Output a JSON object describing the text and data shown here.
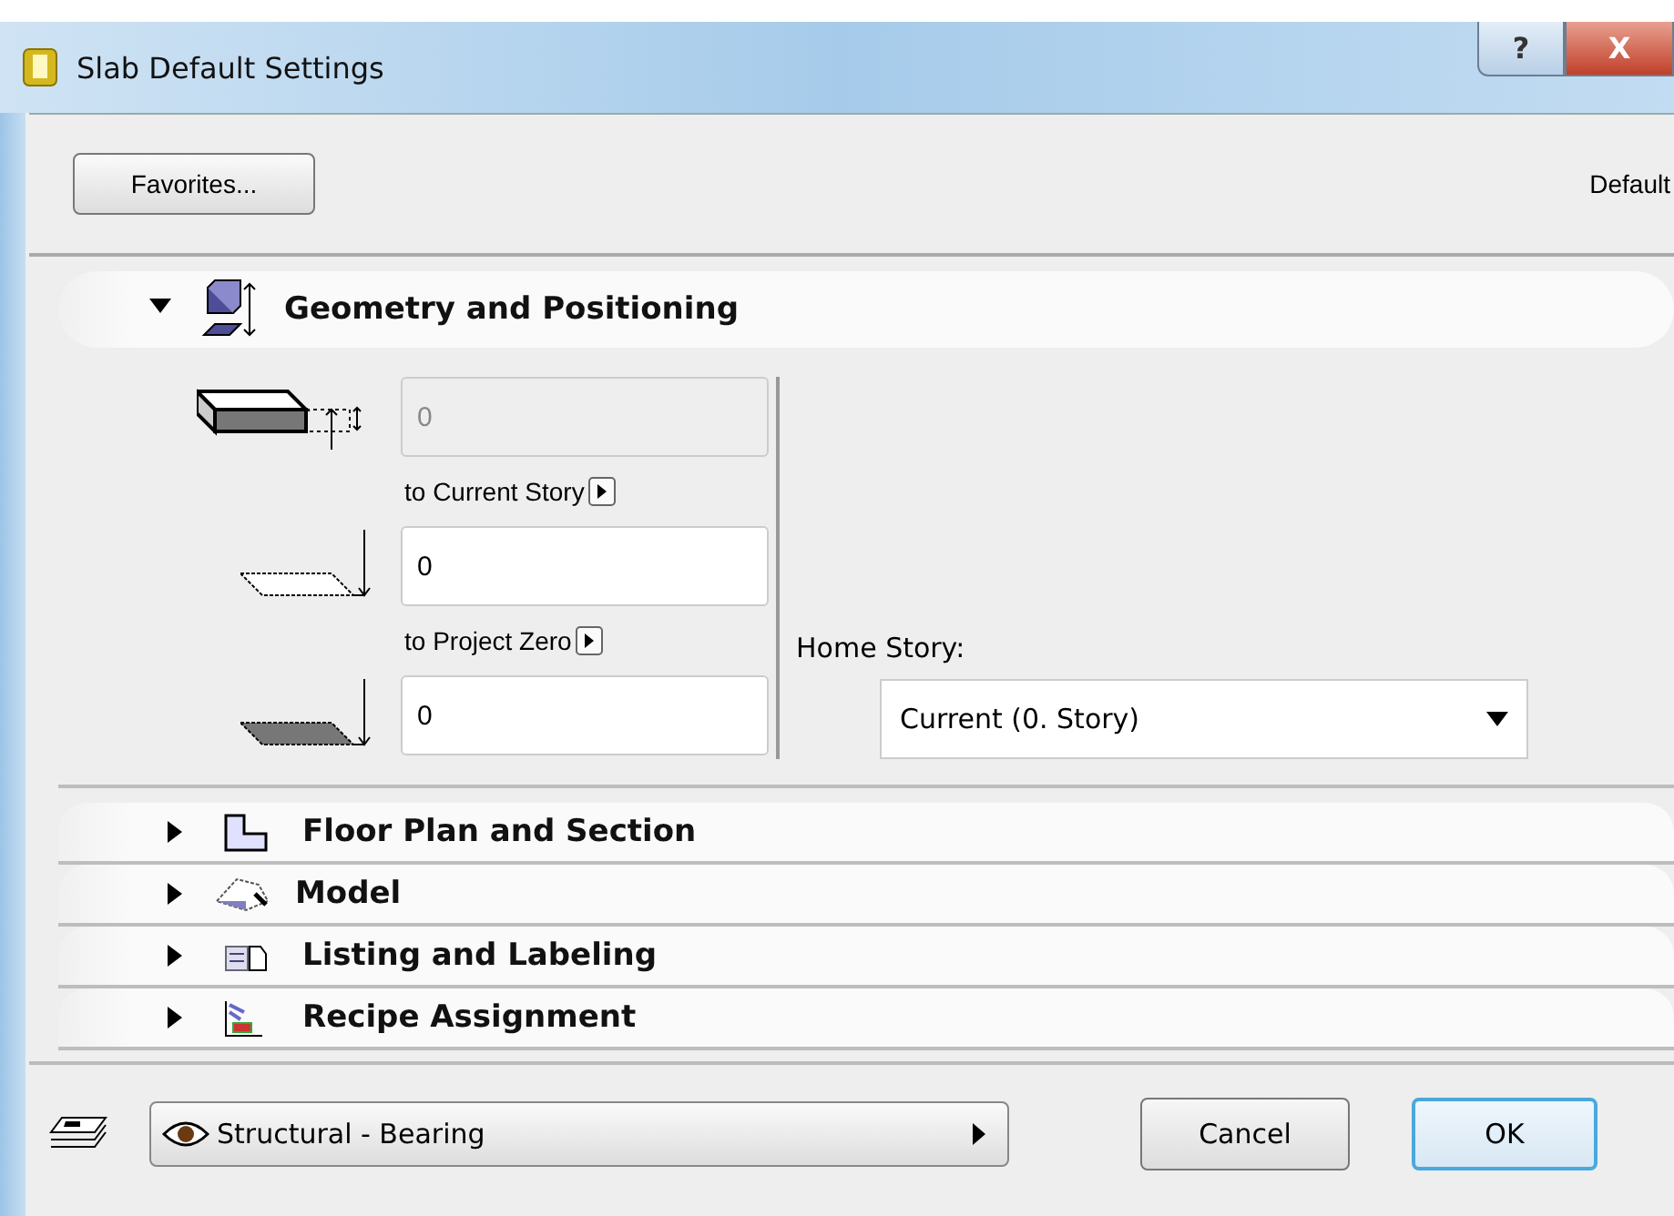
{
  "window": {
    "title": "Slab Default Settings",
    "buttons": [
      {
        "kind": "help",
        "label": "?"
      },
      {
        "kind": "close",
        "label": "X"
      }
    ]
  },
  "toolbar": {
    "favorites_button": "Favorites...",
    "default_label": "Default"
  },
  "sections": [
    {
      "kind": "geometry",
      "label": "Geometry and Positioning",
      "expanded": true
    },
    {
      "kind": "floorplan",
      "label": "Floor Plan and Section",
      "expanded": false
    },
    {
      "kind": "model",
      "label": "Model",
      "expanded": false
    },
    {
      "kind": "listing",
      "label": "Listing and Labeling",
      "expanded": false
    },
    {
      "kind": "recipe",
      "label": "Recipe Assignment",
      "expanded": false
    }
  ],
  "geometry": {
    "fields": [
      {
        "kind": "thickness",
        "value": "0",
        "disabled": true
      },
      {
        "kind": "offset_story",
        "label": "to Current Story",
        "value": "0",
        "disabled": false
      },
      {
        "kind": "offset_zero",
        "label": "to Project Zero",
        "value": "0",
        "disabled": false
      }
    ],
    "home_story": {
      "label": "Home Story:",
      "value": "Current (0. Story)"
    }
  },
  "footer": {
    "layer": "Structural - Bearing",
    "buttons": [
      {
        "label": "Cancel",
        "default": false
      },
      {
        "label": "OK",
        "default": true
      }
    ]
  }
}
